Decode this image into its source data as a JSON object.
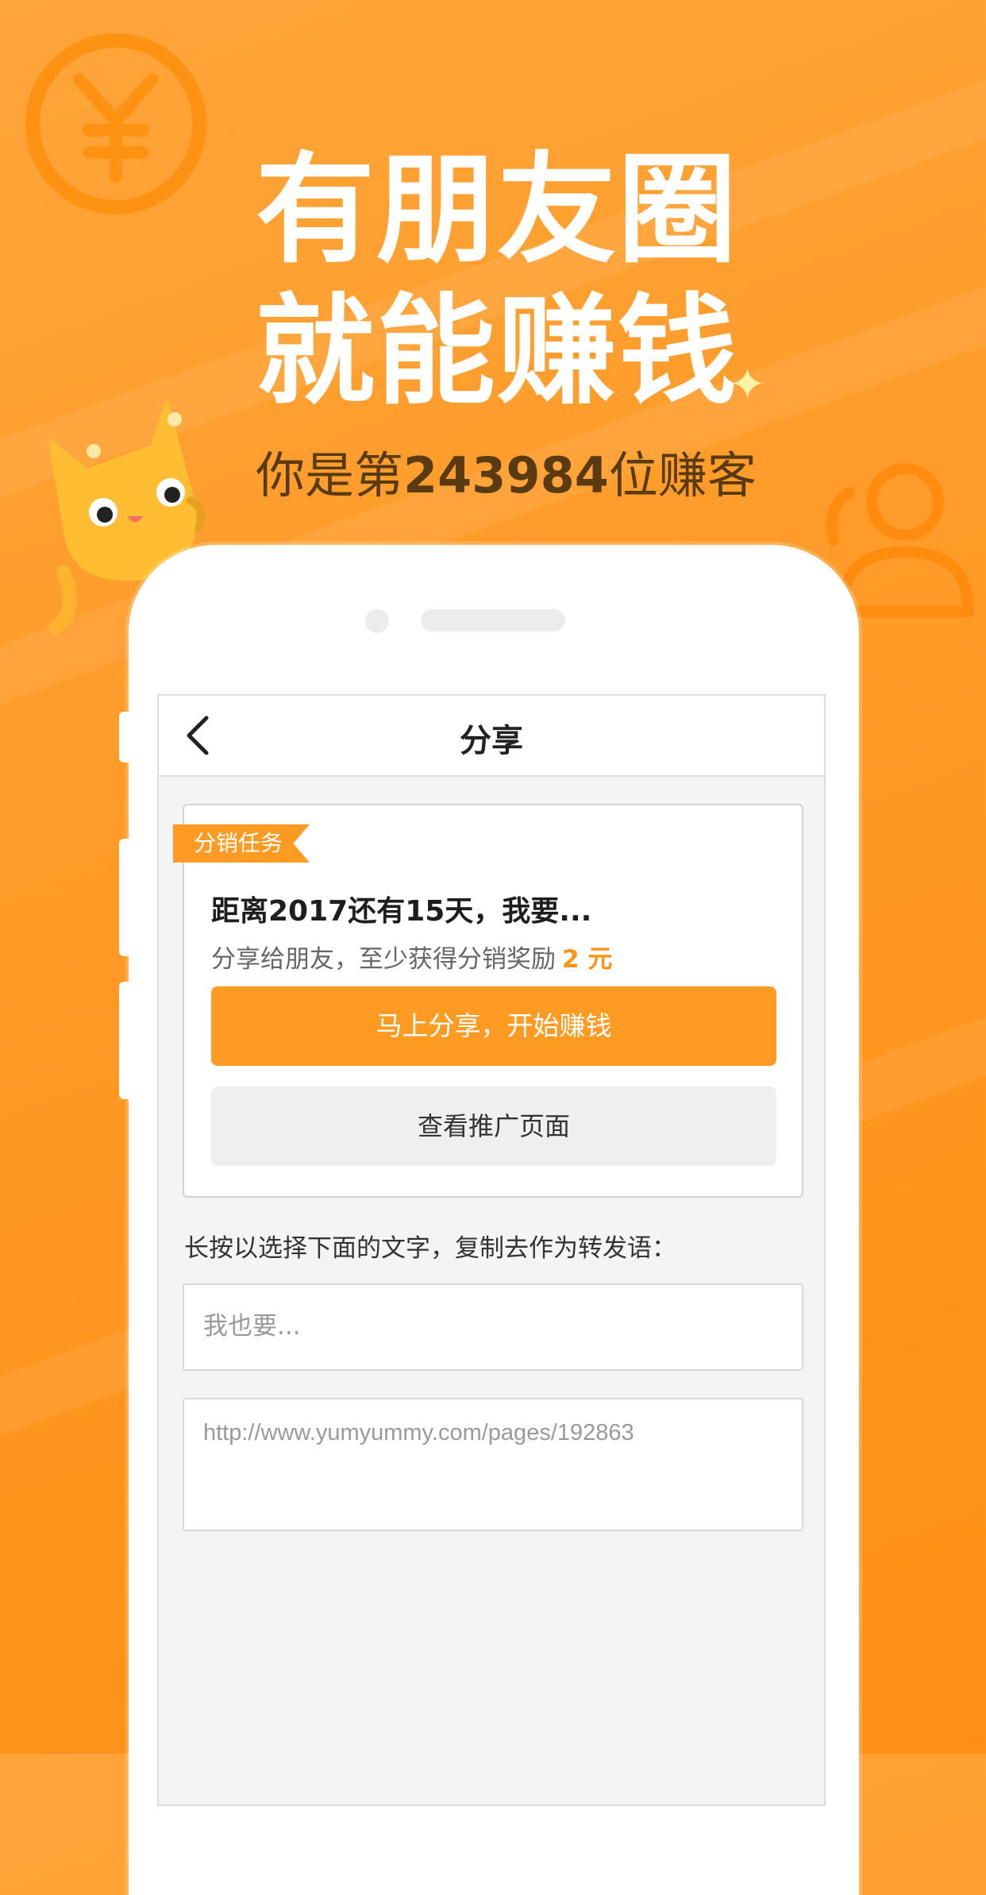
{
  "promo": {
    "headline_line1": "有朋友圈",
    "headline_line2": "就能赚钱",
    "sub_prefix": "你是第",
    "sub_number": "243984",
    "sub_suffix": "位赚客"
  },
  "screen": {
    "nav_title": "分享",
    "card": {
      "tag": "分销任务",
      "title": "距离2017还有15天，我要...",
      "desc_prefix": "分享给朋友，至少获得分销奖励",
      "desc_amount": "2 元",
      "primary_button": "马上分享，开始赚钱",
      "secondary_button": "查看推广页面"
    },
    "copy_hint": "长按以选择下面的文字，复制去作为转发语：",
    "share_text": "我也要...",
    "share_link": "http://www.yumyummy.com/pages/192863"
  },
  "colors": {
    "background": "#ff9a26",
    "accent": "#ff9b22",
    "amount": "#ff9313"
  },
  "icons": [
    "yen-coin-icon",
    "people-icon",
    "sparkle-icon",
    "cat-mascot",
    "back-arrow-icon"
  ]
}
